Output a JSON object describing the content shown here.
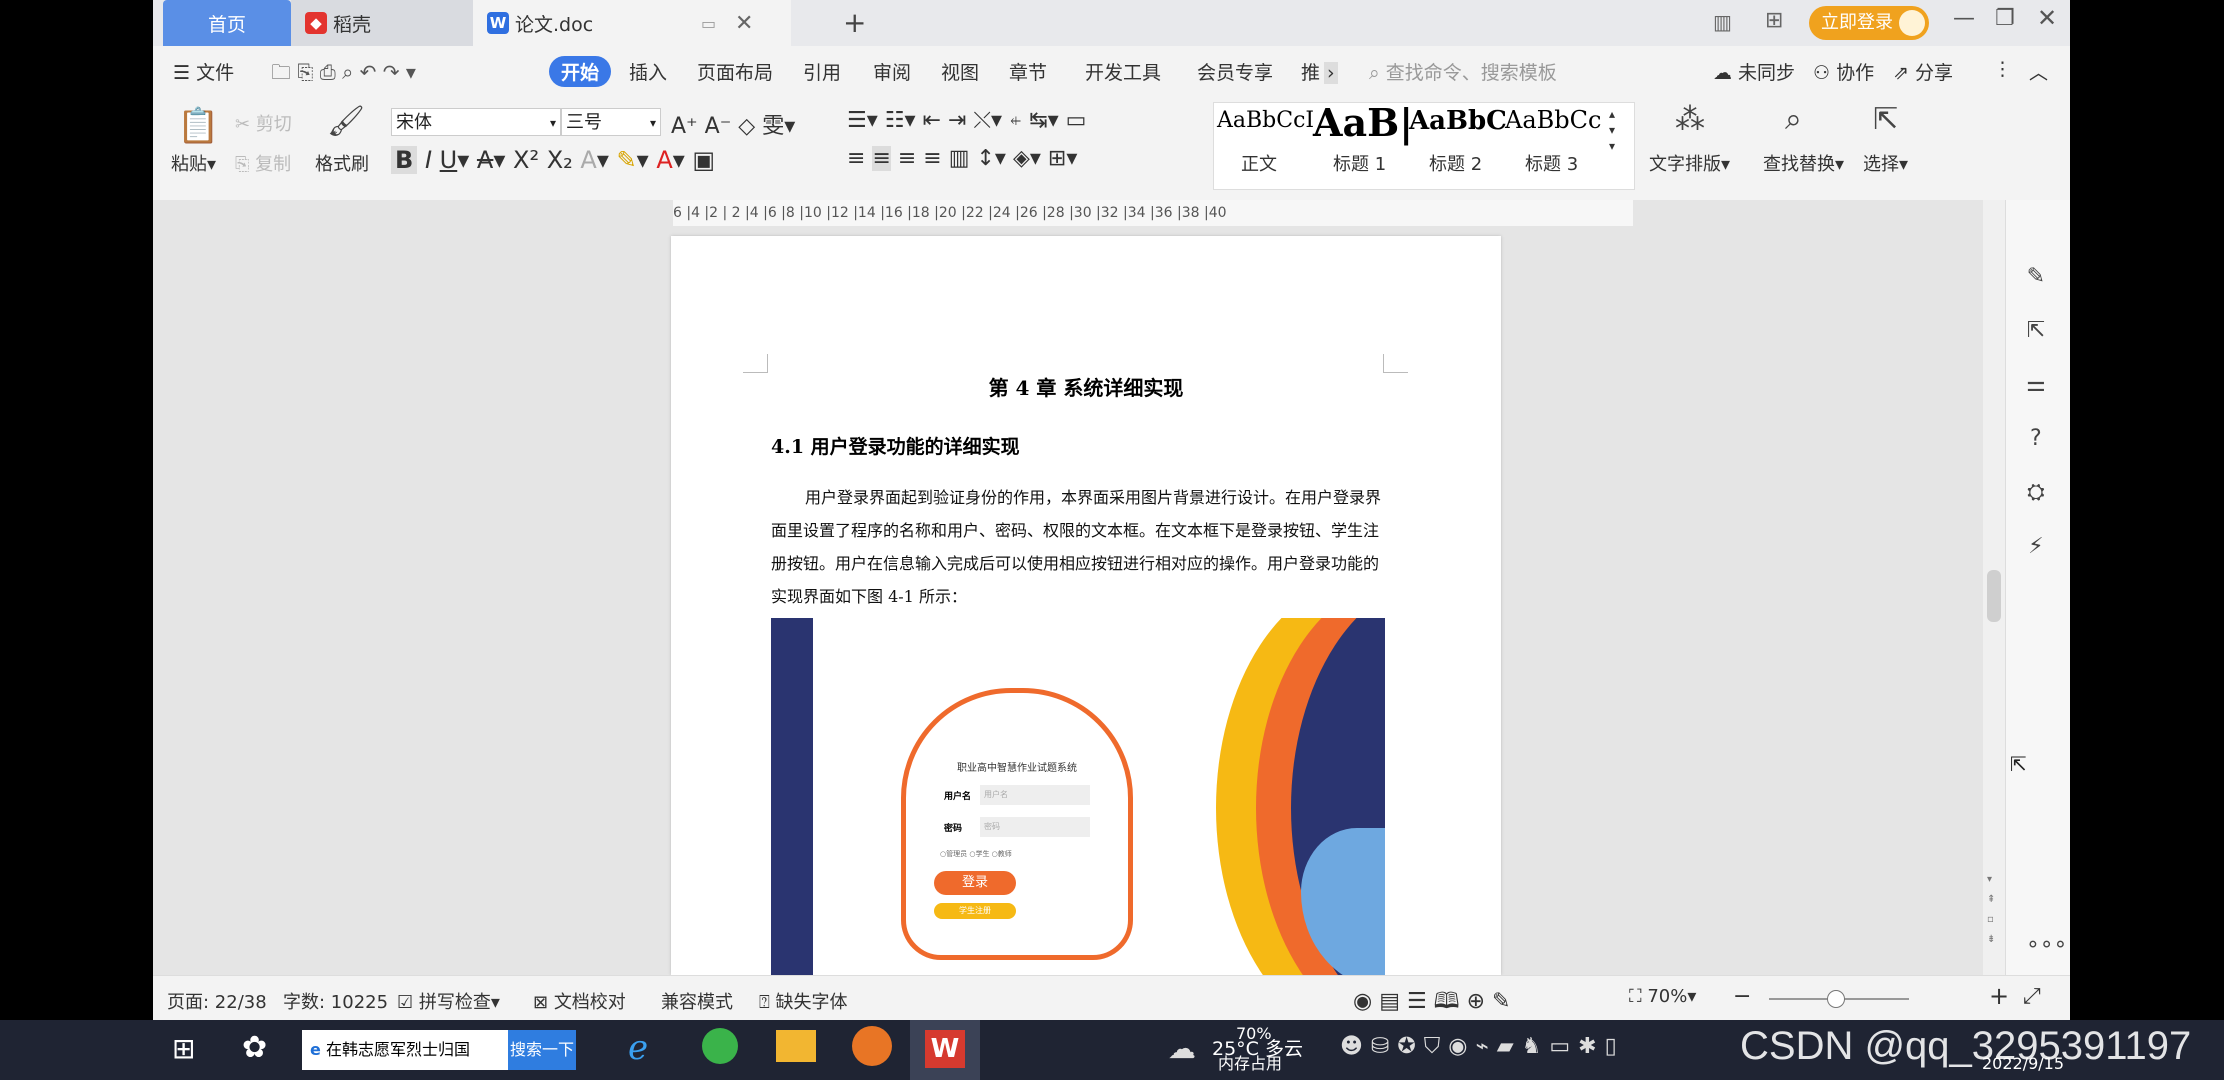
{
  "tabs": {
    "home": "首页",
    "daoke": "稻壳",
    "doc": "论文.doc",
    "login": "立即登录"
  },
  "menu": {
    "file": "文件",
    "items": [
      "开始",
      "插入",
      "页面布局",
      "引用",
      "审阅",
      "视图",
      "章节",
      "开发工具",
      "会员专享",
      "推"
    ],
    "search_placeholder": "查找命令、搜索模板",
    "sync": "未同步",
    "collab": "协作",
    "share": "分享"
  },
  "ribbon": {
    "paste": "粘贴",
    "cut": "剪切",
    "copy": "复制",
    "format_painter": "格式刷",
    "font": "宋体",
    "size": "三号",
    "styles": [
      {
        "preview": "AaBbCcI",
        "name": "正文"
      },
      {
        "preview": "AaB|",
        "name": "标题 1"
      },
      {
        "preview": "AaBbC",
        "name": "标题 2"
      },
      {
        "preview": "AaBbCc",
        "name": "标题 3"
      }
    ],
    "text_layout": "文字排版",
    "find_replace": "查找替换",
    "select": "选择"
  },
  "ruler": "6 |4 |2 | 2 |4 |6 |8 |10 |12 |14 |16 |18 |20 |22 |24 |26 |28 |30 |32 |34 |36 |38 |40",
  "document": {
    "chapter": "第 4 章  系统详细实现",
    "section": "4.1 用户登录功能的详细实现",
    "paragraph": "用户登录界面起到验证身份的作用，本界面采用图片背景进行设计。在用户登录界面里设置了程序的名称和用户、密码、权限的文本框。在文本框下是登录按钮、学生注册按钮。用户在信息输入完成后可以使用相应按钮进行相对应的操作。用户登录功能的实现界面如下图 4-1 所示：",
    "figure": {
      "title": "职业高中智慧作业试题系统",
      "user_label": "用户名",
      "user_placeholder": "用户名",
      "pwd_label": "密码",
      "pwd_placeholder": "密码",
      "roles": [
        "管理员",
        "学生",
        "教师"
      ],
      "login": "登录",
      "register": "学生注册"
    }
  },
  "status": {
    "page": "页面: 22/38",
    "words": "字数: 10225",
    "spell": "拼写检查",
    "proof": "文档校对",
    "compat": "兼容模式",
    "missing_font": "缺失字体",
    "zoom": "70%"
  },
  "taskbar": {
    "news": "在韩志愿军烈士归国",
    "search_btn": "搜索一下",
    "weather": "25°C 多云",
    "mem": "70%",
    "mem_label": "内存占用",
    "date": "2022/9/15",
    "watermark": "CSDN @qq_3295391197"
  },
  "colors": {
    "accent": "#3a78e7",
    "orange": "#ef6a2c",
    "navy": "#2a3470",
    "yellow": "#f6b914"
  }
}
